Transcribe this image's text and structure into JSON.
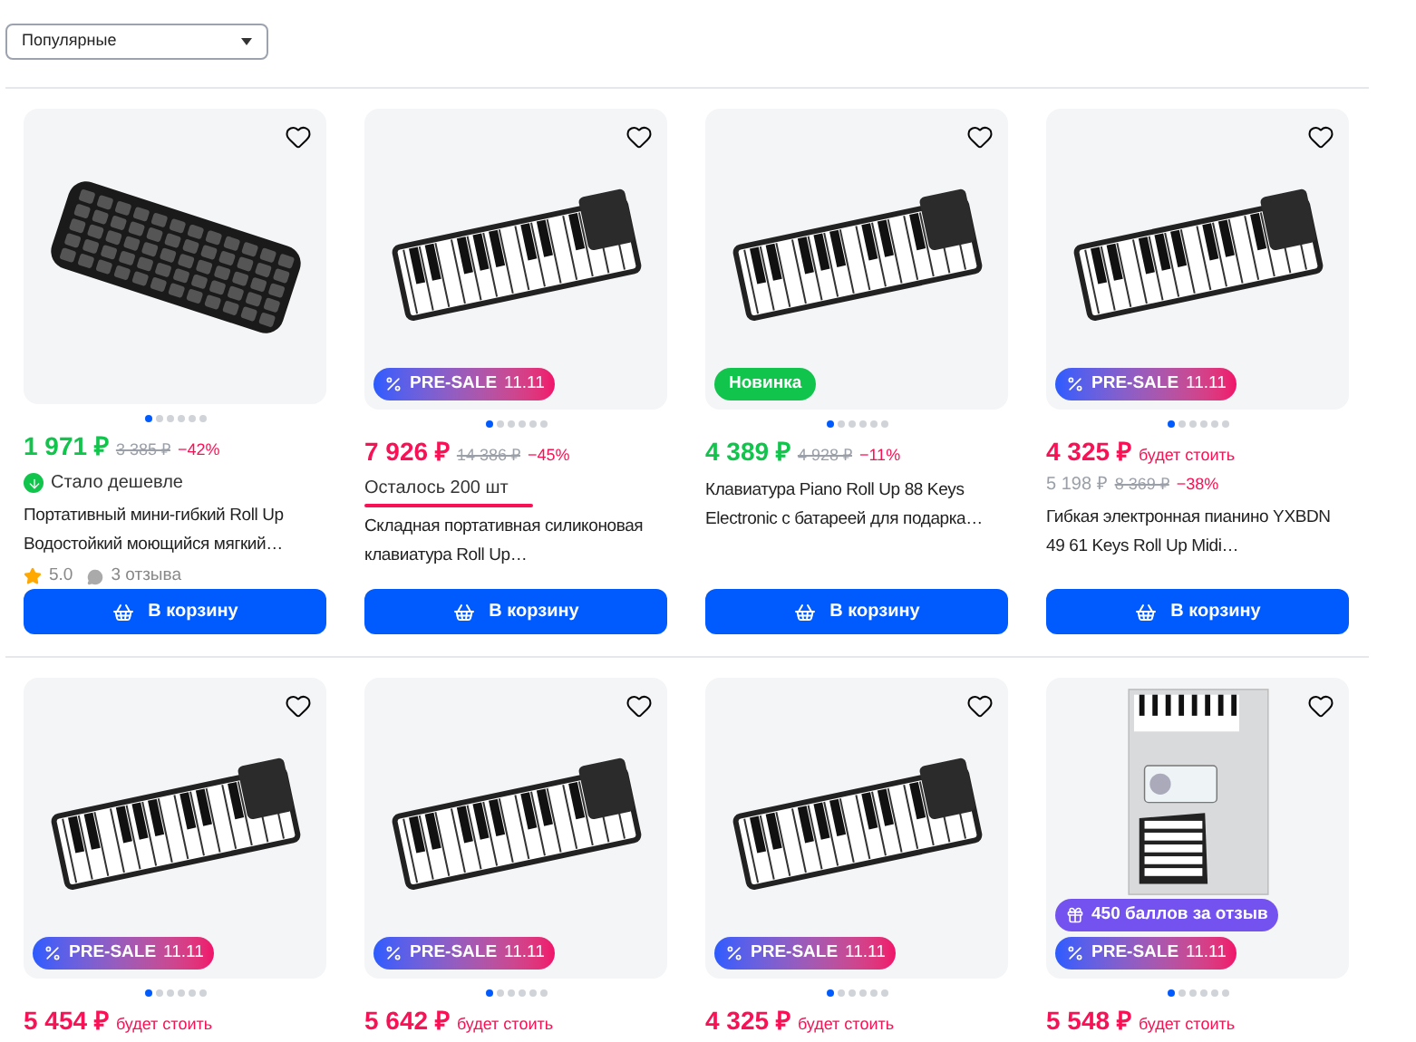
{
  "sort": {
    "value": "Популярные"
  },
  "products": [
    {
      "kind": "discount",
      "slides": [
        true,
        false,
        false,
        false,
        false,
        false
      ],
      "price": "1 971 ₽",
      "old_price": "3 385 ₽",
      "discount": "−42%",
      "extra": {
        "kind": "cheaper",
        "text": "Стало дешевле"
      },
      "title": "Портативный мини-гибкий Roll Up Водостойкий моющийся мягкий…",
      "rating": "5.0",
      "reviews": "3 отзыва",
      "button": "В корзину"
    },
    {
      "kind": "presale",
      "badges": [
        {
          "kind": "presale",
          "text": "PRE-SALE",
          "date": "11.11"
        }
      ],
      "slides": [
        true,
        false,
        false,
        false,
        false,
        false
      ],
      "price": "7 926 ₽",
      "old_price": "14 386 ₽",
      "discount": "−45%",
      "extra": {
        "kind": "stock",
        "text": "Осталось 200 шт"
      },
      "title": "Складная портативная силиконовая клавиатура Roll Up…",
      "button": "В корзину"
    },
    {
      "kind": "discount",
      "badges": [
        {
          "kind": "new",
          "text": "Новинка"
        }
      ],
      "slides": [
        true,
        false,
        false,
        false,
        false,
        false
      ],
      "price": "4 389 ₽",
      "old_price": "4 928 ₽",
      "discount": "−11%",
      "title": "Клавиатура Piano Roll Up 88 Keys Electronic с батареей для подарка…",
      "button": "В корзину"
    },
    {
      "kind": "presale",
      "badges": [
        {
          "kind": "presale",
          "text": "PRE-SALE",
          "date": "11.11"
        }
      ],
      "slides": [
        true,
        false,
        false,
        false,
        false,
        false
      ],
      "price": "4 325 ₽",
      "note": "будет стоить",
      "second": {
        "price": "5 198 ₽",
        "old_price": "8 369 ₽",
        "discount": "−38%"
      },
      "title": "Гибкая электронная пианино YXBDN 49 61 Keys Roll Up Midi…",
      "button": "В корзину"
    },
    {
      "kind": "presale",
      "badges": [
        {
          "kind": "presale",
          "text": "PRE-SALE",
          "date": "11.11"
        }
      ],
      "slides": [
        true,
        false,
        false,
        false,
        false,
        false
      ],
      "price": "5 454 ₽",
      "note": "будет стоить"
    },
    {
      "kind": "presale",
      "badges": [
        {
          "kind": "presale",
          "text": "PRE-SALE",
          "date": "11.11"
        }
      ],
      "slides": [
        true,
        false,
        false,
        false,
        false,
        false
      ],
      "price": "5 642 ₽",
      "note": "будет стоить"
    },
    {
      "kind": "presale",
      "badges": [
        {
          "kind": "presale",
          "text": "PRE-SALE",
          "date": "11.11"
        }
      ],
      "slides": [
        true,
        false,
        false,
        false,
        false,
        false
      ],
      "price": "4 325 ₽",
      "note": "будет стоить"
    },
    {
      "kind": "presale",
      "badges": [
        {
          "kind": "points",
          "text": "450 баллов за отзыв"
        },
        {
          "kind": "presale",
          "text": "PRE-SALE",
          "date": "11.11"
        }
      ],
      "slides": [
        true,
        false,
        false,
        false,
        false,
        false
      ],
      "price": "5 548 ₽",
      "note": "будет стоить"
    }
  ]
}
